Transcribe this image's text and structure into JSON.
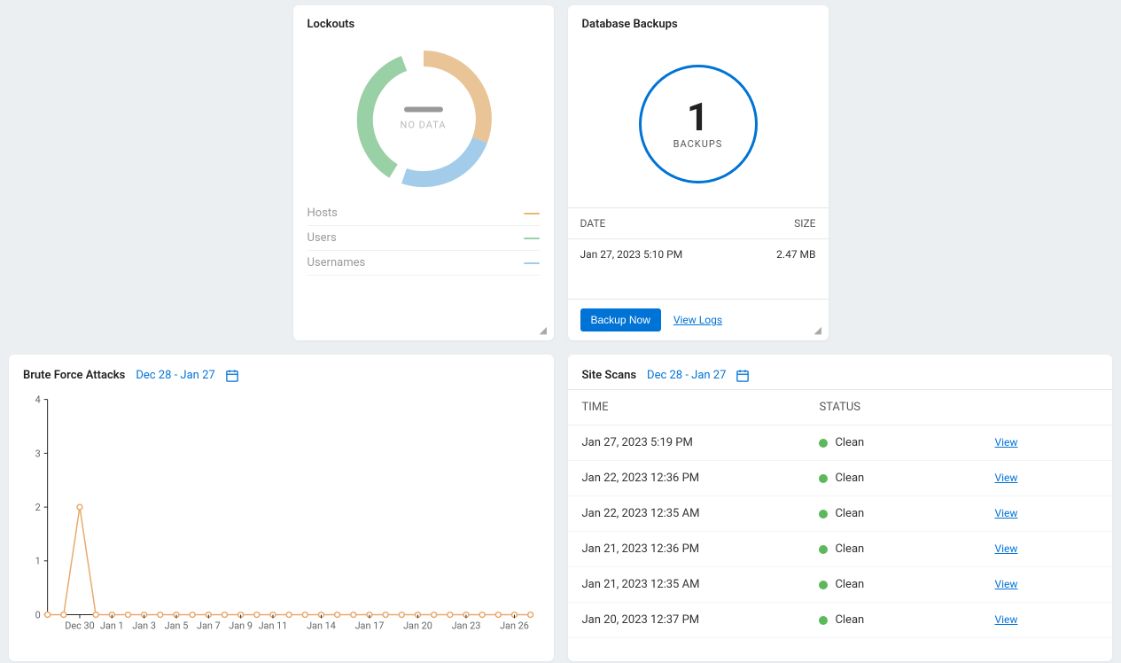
{
  "colors": {
    "lockout_hosts": "#e9b773",
    "lockout_users": "#9ad0a5",
    "lockout_usernames": "#a3cceb",
    "primary": "#0073d6",
    "status_clean": "#5bb85b",
    "line_stroke": "#e9a96b"
  },
  "lockouts": {
    "title": "Lockouts",
    "no_data": "NO DATA",
    "legend": [
      {
        "label": "Hosts",
        "color": "#e9b773"
      },
      {
        "label": "Users",
        "color": "#9ad0a5"
      },
      {
        "label": "Usernames",
        "color": "#a3cceb"
      }
    ]
  },
  "backups": {
    "title": "Database Backups",
    "count": "1",
    "count_label": "BACKUPS",
    "head_date": "DATE",
    "head_size": "SIZE",
    "rows": [
      {
        "date": "Jan 27, 2023 5:10 PM",
        "size": "2.47 MB"
      }
    ],
    "backup_now": "Backup Now",
    "view_logs": "View Logs"
  },
  "brute": {
    "title": "Brute Force Attacks",
    "range": "Dec 28 - Jan 27"
  },
  "scans": {
    "title": "Site Scans",
    "range": "Dec 28 - Jan 27",
    "head_time": "TIME",
    "head_status": "STATUS",
    "view_label": "View",
    "rows": [
      {
        "time": "Jan 27, 2023 5:19 PM",
        "status": "Clean"
      },
      {
        "time": "Jan 22, 2023 12:36 PM",
        "status": "Clean"
      },
      {
        "time": "Jan 22, 2023 12:35 AM",
        "status": "Clean"
      },
      {
        "time": "Jan 21, 2023 12:36 PM",
        "status": "Clean"
      },
      {
        "time": "Jan 21, 2023 12:35 AM",
        "status": "Clean"
      },
      {
        "time": "Jan 20, 2023 12:37 PM",
        "status": "Clean"
      }
    ]
  },
  "chart_data": {
    "type": "line",
    "title": "Brute Force Attacks",
    "xlabel": "",
    "ylabel": "",
    "ylim": [
      0,
      4
    ],
    "yticks": [
      0,
      1,
      2,
      3,
      4
    ],
    "categories": [
      "Dec 28",
      "Dec 29",
      "Dec 30",
      "Dec 31",
      "Jan 1",
      "Jan 2",
      "Jan 3",
      "Jan 4",
      "Jan 5",
      "Jan 6",
      "Jan 7",
      "Jan 8",
      "Jan 9",
      "Jan 10",
      "Jan 11",
      "Jan 12",
      "Jan 13",
      "Jan 14",
      "Jan 15",
      "Jan 16",
      "Jan 17",
      "Jan 18",
      "Jan 19",
      "Jan 20",
      "Jan 21",
      "Jan 22",
      "Jan 23",
      "Jan 24",
      "Jan 25",
      "Jan 26",
      "Jan 27"
    ],
    "xtick_labels": [
      "Dec 30",
      "Jan 1",
      "Jan 3",
      "Jan 5",
      "Jan 7",
      "Jan 9",
      "Jan 11",
      "Jan 14",
      "Jan 17",
      "Jan 20",
      "Jan 23",
      "Jan 26"
    ],
    "values": [
      0,
      0,
      2,
      0,
      0,
      0,
      0,
      0,
      0,
      0,
      0,
      0,
      0,
      0,
      0,
      0,
      0,
      0,
      0,
      0,
      0,
      0,
      0,
      0,
      0,
      0,
      0,
      0,
      0,
      0,
      0
    ]
  }
}
